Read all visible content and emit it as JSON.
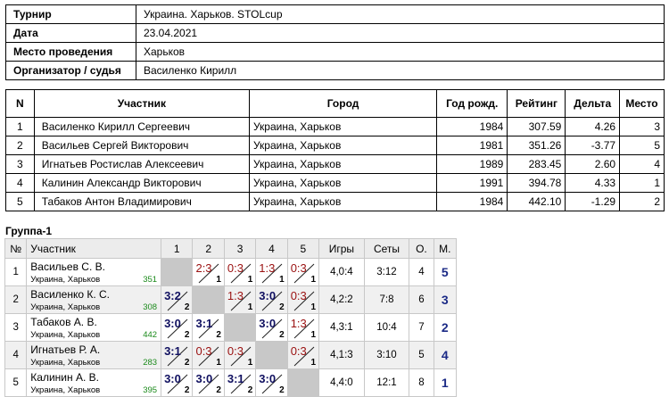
{
  "info": {
    "rows": [
      {
        "label": "Турнир",
        "value": "Украина. Харьков. STOLcup"
      },
      {
        "label": "Дата",
        "value": "23.04.2021"
      },
      {
        "label": "Место проведения",
        "value": "Харьков"
      },
      {
        "label": "Организатор / судья",
        "value": "Василенко Кирилл"
      }
    ]
  },
  "participants": {
    "headers": [
      "N",
      "Участник",
      "Город",
      "Год рожд.",
      "Рейтинг",
      "Дельта",
      "Место"
    ],
    "rows": [
      {
        "n": "1",
        "name": "Василенко Кирилл Сергеевич",
        "city": "Украина, Харьков",
        "year": "1984",
        "rating": "307.59",
        "delta": "4.26",
        "place": "3"
      },
      {
        "n": "2",
        "name": "Васильев Сергей Викторович",
        "city": "Украина, Харьков",
        "year": "1981",
        "rating": "351.26",
        "delta": "-3.77",
        "place": "5"
      },
      {
        "n": "3",
        "name": "Игнатьев Ростислав Алексеевич",
        "city": "Украина, Харьков",
        "year": "1989",
        "rating": "283.45",
        "delta": "2.60",
        "place": "4"
      },
      {
        "n": "4",
        "name": "Калинин Александр Викторович",
        "city": "Украина, Харьков",
        "year": "1991",
        "rating": "394.78",
        "delta": "4.33",
        "place": "1"
      },
      {
        "n": "5",
        "name": "Табаков Антон Владимирович",
        "city": "Украина, Харьков",
        "year": "1984",
        "rating": "442.10",
        "delta": "-1.29",
        "place": "2"
      }
    ]
  },
  "group": {
    "title": "Группа-1",
    "headers": {
      "num": "№",
      "player": "Участник",
      "cols": [
        "1",
        "2",
        "3",
        "4",
        "5"
      ],
      "games": "Игры",
      "sets": "Сеты",
      "points": "О.",
      "place": "М."
    },
    "rows": [
      {
        "num": "1",
        "name": "Васильев С. В.",
        "city": "Украина, Харьков",
        "rating": "351",
        "cells": [
          null,
          {
            "score": "2:3",
            "pts": "1",
            "win": false
          },
          {
            "score": "0:3",
            "pts": "1",
            "win": false
          },
          {
            "score": "1:3",
            "pts": "1",
            "win": false
          },
          {
            "score": "0:3",
            "pts": "1",
            "win": false
          }
        ],
        "games": "4,0:4",
        "sets": "3:12",
        "points": "4",
        "place": "5"
      },
      {
        "num": "2",
        "name": "Василенко К. С.",
        "city": "Украина, Харьков",
        "rating": "308",
        "cells": [
          {
            "score": "3:2",
            "pts": "2",
            "win": true
          },
          null,
          {
            "score": "1:3",
            "pts": "1",
            "win": false
          },
          {
            "score": "3:0",
            "pts": "2",
            "win": true
          },
          {
            "score": "0:3",
            "pts": "1",
            "win": false
          }
        ],
        "games": "4,2:2",
        "sets": "7:8",
        "points": "6",
        "place": "3"
      },
      {
        "num": "3",
        "name": "Табаков А. В.",
        "city": "Украина, Харьков",
        "rating": "442",
        "cells": [
          {
            "score": "3:0",
            "pts": "2",
            "win": true
          },
          {
            "score": "3:1",
            "pts": "2",
            "win": true
          },
          null,
          {
            "score": "3:0",
            "pts": "2",
            "win": true
          },
          {
            "score": "1:3",
            "pts": "1",
            "win": false
          }
        ],
        "games": "4,3:1",
        "sets": "10:4",
        "points": "7",
        "place": "2"
      },
      {
        "num": "4",
        "name": "Игнатьев Р. А.",
        "city": "Украина, Харьков",
        "rating": "283",
        "cells": [
          {
            "score": "3:1",
            "pts": "2",
            "win": true
          },
          {
            "score": "0:3",
            "pts": "1",
            "win": false
          },
          {
            "score": "0:3",
            "pts": "1",
            "win": false
          },
          null,
          {
            "score": "0:3",
            "pts": "1",
            "win": false
          }
        ],
        "games": "4,1:3",
        "sets": "3:10",
        "points": "5",
        "place": "4"
      },
      {
        "num": "5",
        "name": "Калинин А. В.",
        "city": "Украина, Харьков",
        "rating": "395",
        "cells": [
          {
            "score": "3:0",
            "pts": "2",
            "win": true
          },
          {
            "score": "3:0",
            "pts": "2",
            "win": true
          },
          {
            "score": "3:1",
            "pts": "2",
            "win": true
          },
          {
            "score": "3:0",
            "pts": "2",
            "win": true
          },
          null
        ],
        "games": "4,4:0",
        "sets": "12:1",
        "points": "8",
        "place": "1"
      }
    ]
  }
}
